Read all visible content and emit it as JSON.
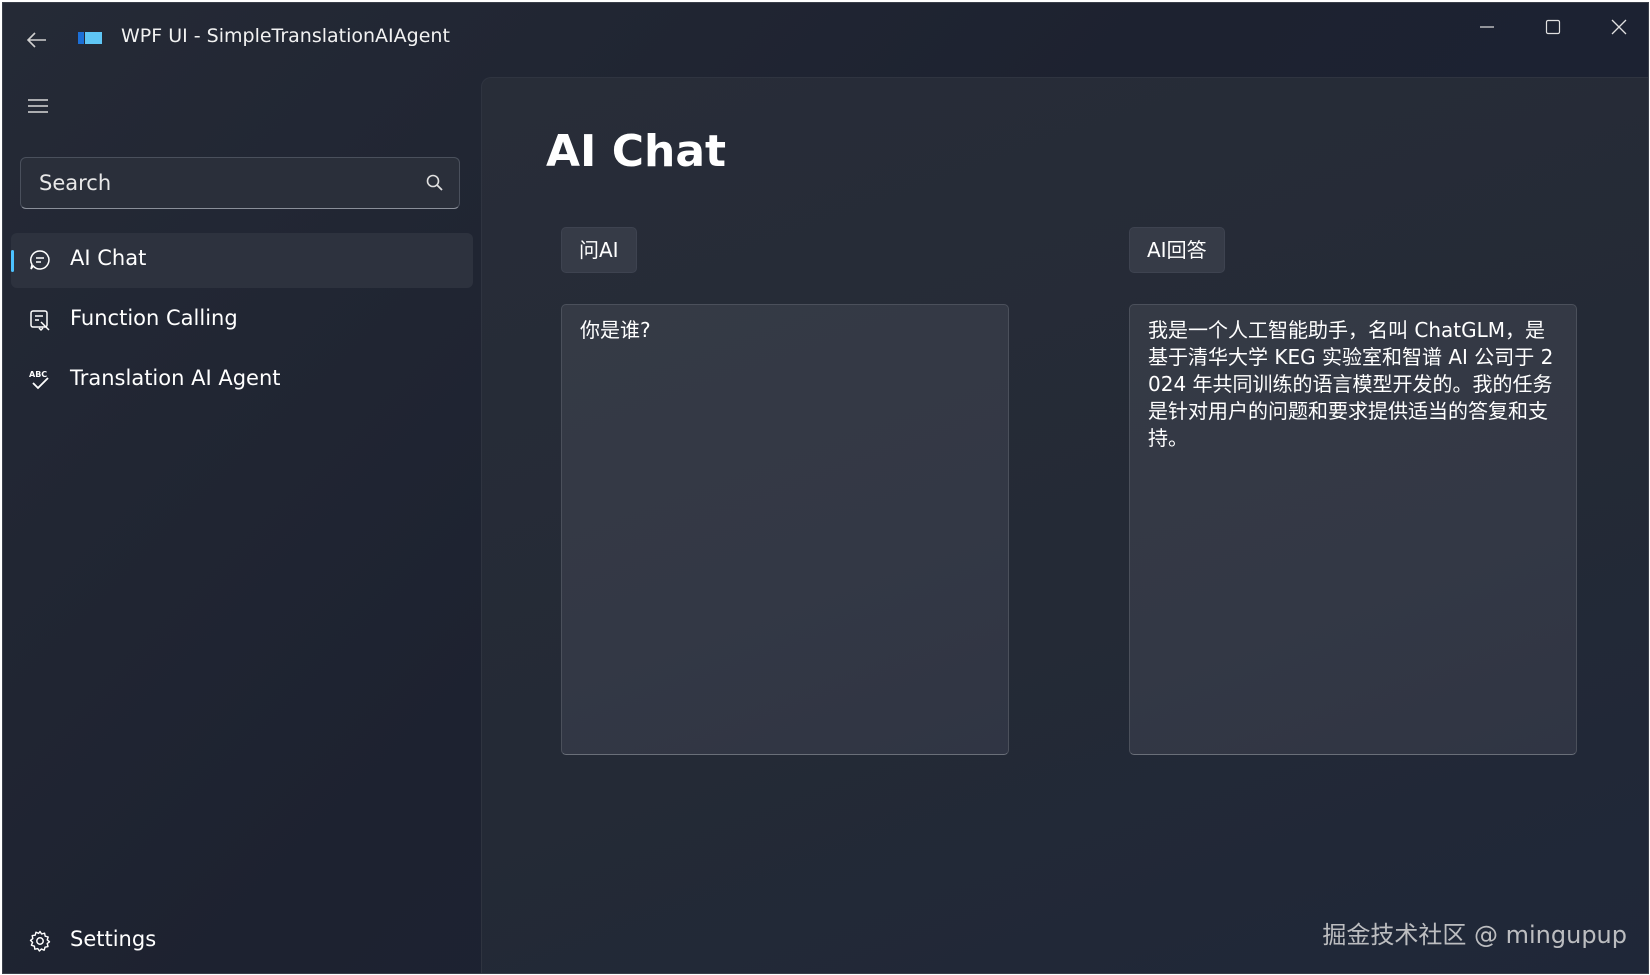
{
  "window": {
    "title": "WPF UI - SimpleTranslationAIAgent"
  },
  "sidebar": {
    "search_placeholder": "Search",
    "items": [
      {
        "label": "AI Chat",
        "icon": "chat-icon",
        "selected": true
      },
      {
        "label": "Function Calling",
        "icon": "function-icon",
        "selected": false
      },
      {
        "label": "Translation AI Agent",
        "icon": "spellcheck-icon",
        "selected": false
      }
    ],
    "footer": {
      "label": "Settings",
      "icon": "gear-icon"
    }
  },
  "main": {
    "title": "AI Chat",
    "ask_button": "问AI",
    "answer_label": "AI回答",
    "question_text": "你是谁?",
    "answer_text": "我是一个人工智能助手，名叫 ChatGLM，是基于清华大学 KEG 实验室和智谱 AI 公司于 2024 年共同训练的语言模型开发的。我的任务是针对用户的问题和要求提供适当的答复和支持。"
  },
  "watermark": "掘金技术社区 @ mingupup",
  "colors": {
    "accent": "#4cc2ff",
    "background": "#202532",
    "panel": "#282d38",
    "textbox": "#353a45"
  }
}
